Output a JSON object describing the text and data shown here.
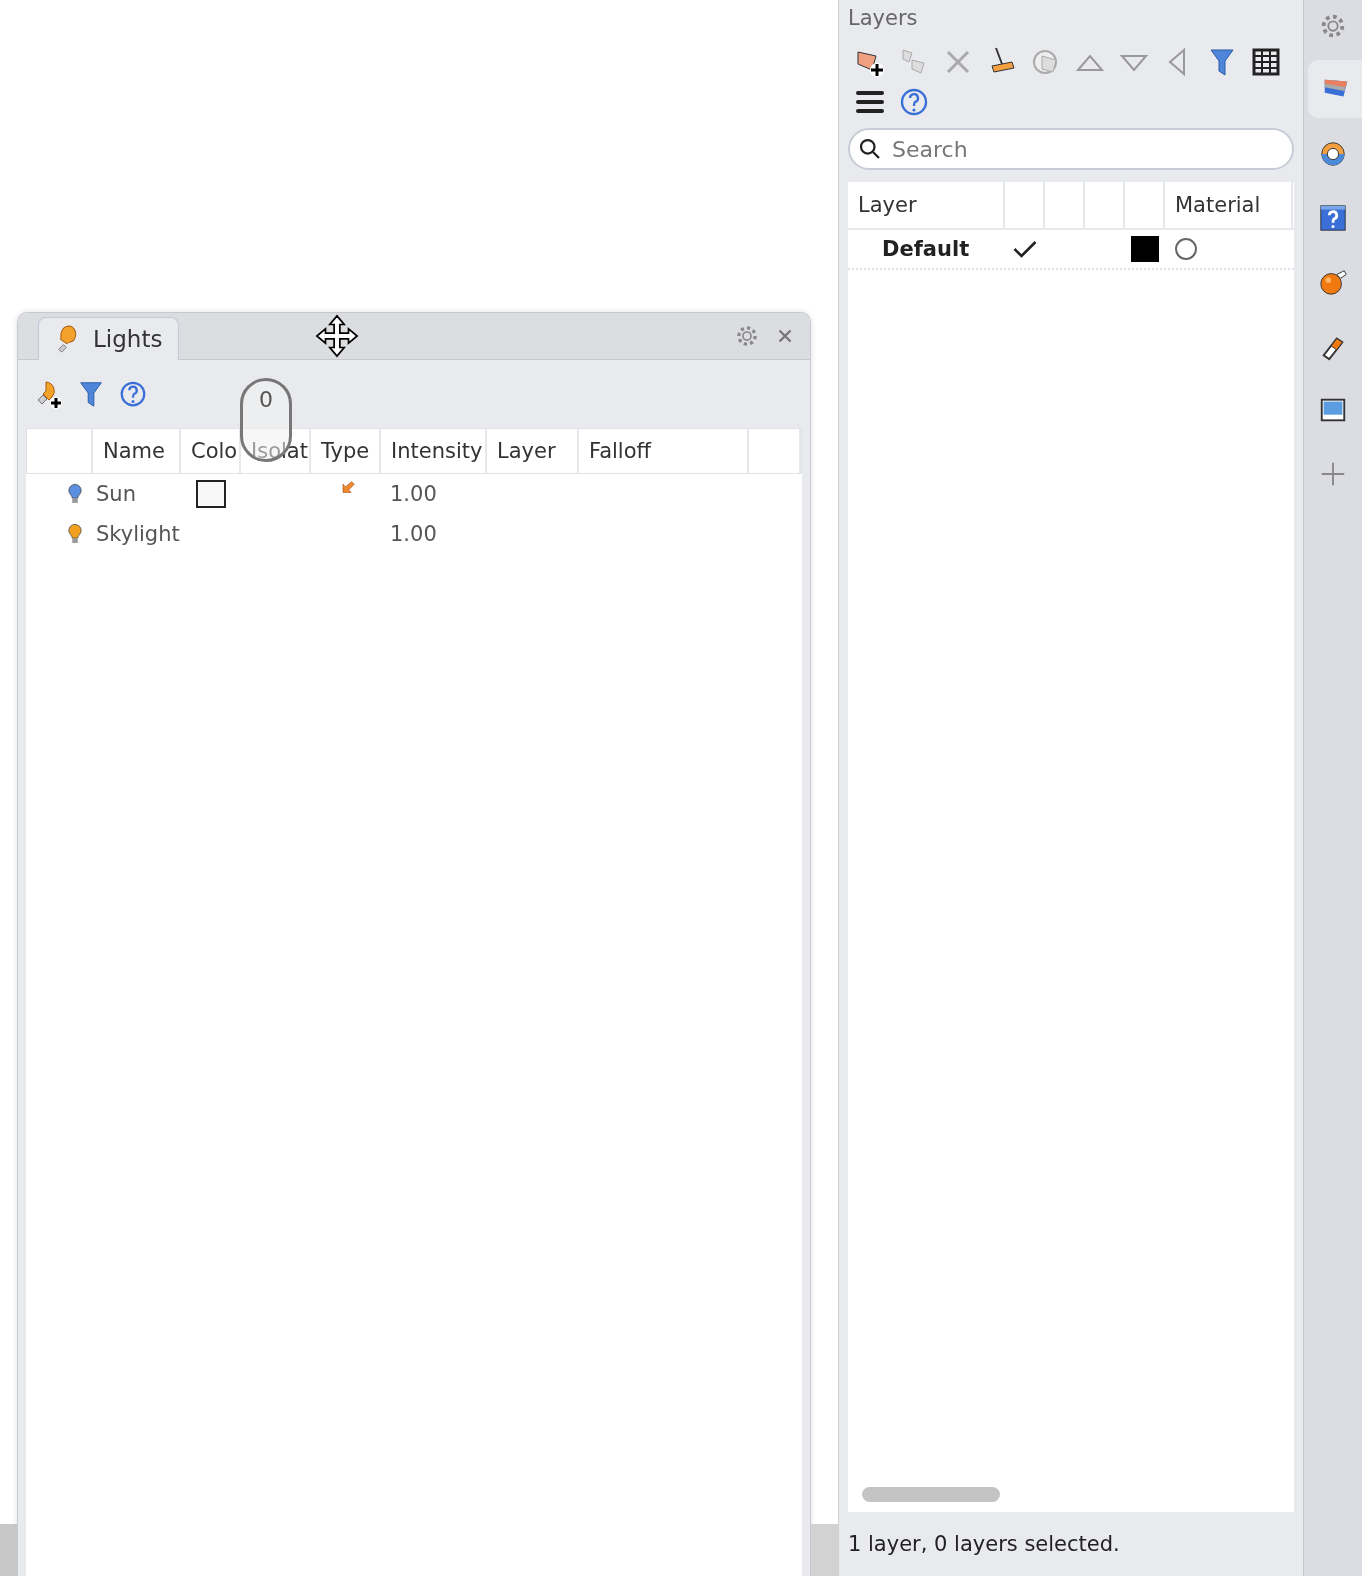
{
  "lights_panel": {
    "tab": {
      "label": "Lights",
      "selected": true
    },
    "columns": [
      {
        "kind": "blank"
      },
      {
        "kind": "text",
        "label": "Name"
      },
      {
        "kind": "text",
        "label": "Colo"
      },
      {
        "kind": "text",
        "label": "Isolat"
      },
      {
        "kind": "text",
        "label": "Type"
      },
      {
        "kind": "text",
        "label": "Intensity"
      },
      {
        "kind": "text",
        "label": "Layer"
      },
      {
        "kind": "text",
        "label": "Falloff"
      },
      {
        "kind": "blank"
      }
    ],
    "rows": [
      {
        "name": "Sun",
        "color": "#5b8fe0",
        "has_color_swatch": true,
        "has_type_icon": true,
        "intensity": "1.00"
      },
      {
        "name": "Skylight",
        "color": "#f2a020",
        "has_color_swatch": false,
        "has_type_icon": false,
        "intensity": "1.00"
      }
    ]
  },
  "mouse_overlay": {
    "button": "0"
  },
  "layers_panel": {
    "title": "Layers",
    "search": {
      "placeholder": "Search"
    },
    "columns": [
      {
        "kind": "text",
        "label": "Layer"
      },
      {
        "kind": "blank"
      },
      {
        "kind": "blank"
      },
      {
        "kind": "blank"
      },
      {
        "kind": "blank"
      },
      {
        "kind": "text",
        "label": "Material"
      }
    ],
    "rows": [
      {
        "name": "Default",
        "current": true,
        "color": "#000000"
      }
    ],
    "status_bar": "1 layer, 0 layers selected."
  },
  "side_tabs": [
    {
      "kind": "gear",
      "selected": false
    },
    {
      "kind": "layers",
      "selected": true
    },
    {
      "kind": "lens",
      "selected": false
    },
    {
      "kind": "help",
      "selected": false
    },
    {
      "kind": "sphere",
      "selected": false
    },
    {
      "kind": "tube",
      "selected": false
    },
    {
      "kind": "display",
      "selected": false
    },
    {
      "kind": "plus",
      "selected": false
    }
  ]
}
